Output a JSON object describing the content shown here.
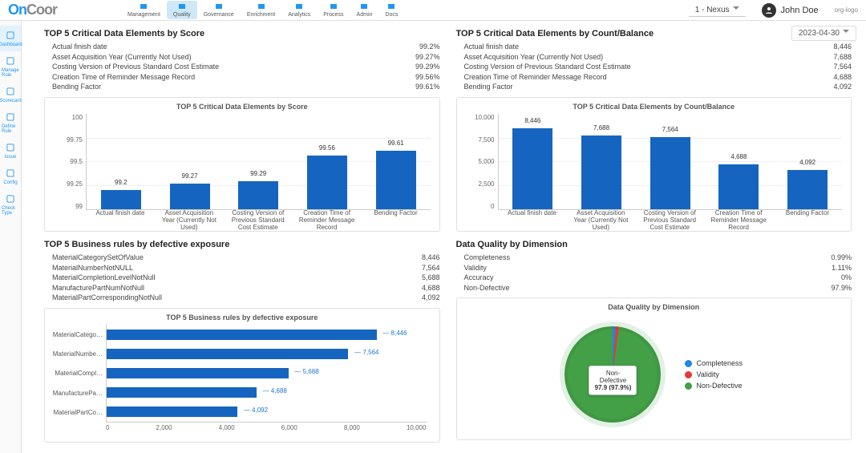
{
  "brand": "OnCoor",
  "topnav": [
    {
      "label": "Management",
      "active": false
    },
    {
      "label": "Quality",
      "active": true
    },
    {
      "label": "Governance",
      "active": false
    },
    {
      "label": "Enrichment",
      "active": false
    },
    {
      "label": "Analytics",
      "active": false
    },
    {
      "label": "Process",
      "active": false
    },
    {
      "label": "Admin",
      "active": false
    },
    {
      "label": "Docs",
      "active": false
    }
  ],
  "env": "1 - Nexus",
  "user": "John Doe",
  "orglogo": "org-logo",
  "date": "2023-04-30",
  "sidebar": [
    {
      "label": "Dashboard",
      "active": true
    },
    {
      "label": "Manage Rule",
      "active": false
    },
    {
      "label": "Scorecard",
      "active": false
    },
    {
      "label": "Define Rule",
      "active": false
    },
    {
      "label": "Issue",
      "active": false
    },
    {
      "label": "Config",
      "active": false
    },
    {
      "label": "Check Type",
      "active": false
    }
  ],
  "panels": {
    "score": {
      "title": "TOP 5 Critical Data Elements by Score",
      "rows": [
        {
          "k": "Actual finish date",
          "v": "99.2%"
        },
        {
          "k": "Asset Acquisition Year (Currently Not Used)",
          "v": "99.27%"
        },
        {
          "k": "Costing Version of Previous Standard Cost Estimate",
          "v": "99.29%"
        },
        {
          "k": "Creation Time of Reminder Message Record",
          "v": "99.56%"
        },
        {
          "k": "Bending Factor",
          "v": "99.61%"
        }
      ],
      "chart_title": "TOP 5 Critical Data Elements by Score"
    },
    "count": {
      "title": "TOP 5 Critical Data Elements by Count/Balance",
      "rows": [
        {
          "k": "Actual finish date",
          "v": "8,446"
        },
        {
          "k": "Asset Acquisition Year (Currently Not Used)",
          "v": "7,688"
        },
        {
          "k": "Costing Version of Previous Standard Cost Estimate",
          "v": "7,564"
        },
        {
          "k": "Creation Time of Reminder Message Record",
          "v": "4,688"
        },
        {
          "k": "Bending Factor",
          "v": "4,092"
        }
      ],
      "chart_title": "TOP 5 Critical Data Elements by Count/Balance"
    },
    "rules": {
      "title": "TOP 5 Business rules by defective exposure",
      "rows": [
        {
          "k": "MaterialCategorySetOfValue",
          "v": "8,446"
        },
        {
          "k": "MaterialNumberNotNULL",
          "v": "7,564"
        },
        {
          "k": "MaterialCompletionLevelNotNull",
          "v": "5,688"
        },
        {
          "k": "ManufacturePartNumNotNull",
          "v": "4,688"
        },
        {
          "k": "MaterialPartCorrespondingNotNull",
          "v": "4,092"
        }
      ],
      "chart_title": "TOP 5 Business rules by defective exposure"
    },
    "dim": {
      "title": "Data Quality by Dimension",
      "rows": [
        {
          "k": "Completeness",
          "v": "0.99%"
        },
        {
          "k": "Validity",
          "v": "1.11%"
        },
        {
          "k": "Accuracy",
          "v": "0%"
        },
        {
          "k": "Non-Defective",
          "v": "97.9%"
        }
      ],
      "chart_title": "Data Quality by Dimension",
      "tooltip_name": "Non-Defective",
      "tooltip_val": "97.9 (97.9%)",
      "legend": [
        "Completeness",
        "Validity",
        "Non-Defective"
      ]
    }
  },
  "chart_data": [
    {
      "type": "bar",
      "title": "TOP 5 Critical Data Elements by Score",
      "categories": [
        "Actual finish date",
        "Asset Acquisition Year (Currently Not Used)",
        "Costing Version of Previous Standard Cost Estimate",
        "Creation Time of Reminder Message Record",
        "Bending Factor"
      ],
      "values": [
        99.2,
        99.27,
        99.29,
        99.56,
        99.61
      ],
      "ylim": [
        99.0,
        100.0
      ],
      "yticks": [
        99.0,
        99.25,
        99.5,
        99.75,
        100.0
      ]
    },
    {
      "type": "bar",
      "title": "TOP 5 Critical Data Elements by Count/Balance",
      "categories": [
        "Actual finish date",
        "Asset Acquisition Year (Currently Not Used)",
        "Costing Version of Previous Standard Cost Estimate",
        "Creation Time of Reminder Message Record",
        "Bending Factor"
      ],
      "values": [
        8446,
        7688,
        7564,
        4688,
        4092
      ],
      "ylim": [
        0,
        10000
      ],
      "yticks": [
        0,
        2500,
        5000,
        7500,
        10000
      ]
    },
    {
      "type": "bar",
      "orientation": "horizontal",
      "title": "TOP 5 Business rules by defective exposure",
      "categories": [
        "MaterialCategorySetOfValue",
        "MaterialNumberNotNULL",
        "MaterialCompletionLevelNotNull",
        "ManufacturePartNumNotNull",
        "MaterialPartCorrespondingNotNull"
      ],
      "categories_truncated": [
        "MaterialCatego…",
        "MaterialNumbe…",
        "MaterialCompl…",
        "ManufacturePa…",
        "MaterialPartCo…"
      ],
      "values": [
        8446,
        7564,
        5688,
        4688,
        4092
      ],
      "xlim": [
        0,
        10000
      ],
      "xticks": [
        0,
        2000,
        4000,
        6000,
        8000,
        10000
      ]
    },
    {
      "type": "pie",
      "title": "Data Quality by Dimension",
      "series": [
        {
          "name": "Completeness",
          "value": 0.99,
          "color": "#1e88e5"
        },
        {
          "name": "Validity",
          "value": 1.11,
          "color": "#e53935"
        },
        {
          "name": "Non-Defective",
          "value": 97.9,
          "color": "#43a047"
        }
      ]
    }
  ]
}
